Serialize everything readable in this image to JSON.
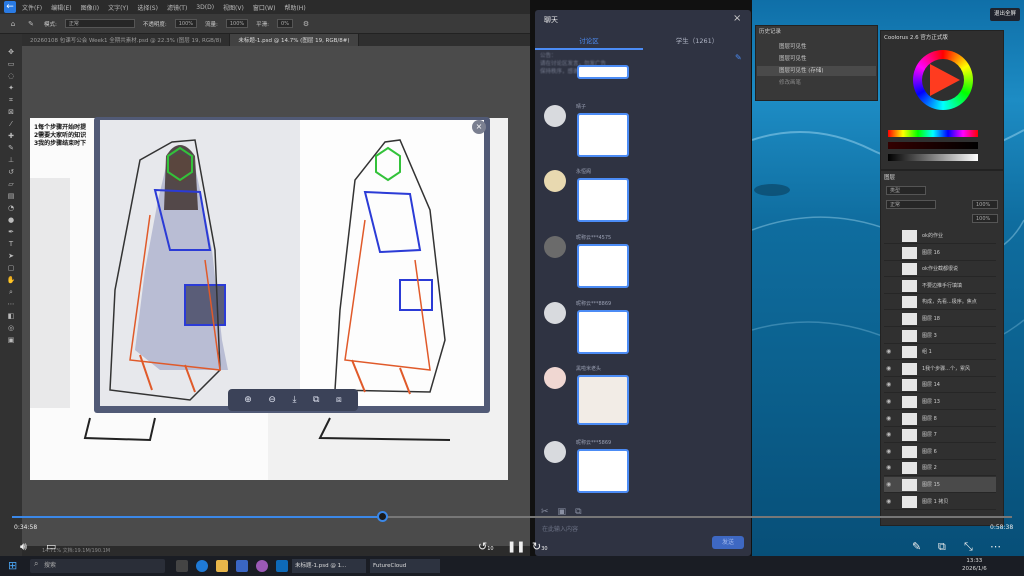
{
  "photoshop": {
    "menu": [
      "文件(F)",
      "编辑(E)",
      "图像(I)",
      "文字(Y)",
      "选择(S)",
      "滤镜(T)",
      "3D(D)",
      "视图(V)",
      "窗口(W)",
      "帮助(H)"
    ],
    "options": {
      "mode_label": "模式:",
      "mode_value": "正常",
      "opacity_label": "不透明度:",
      "opacity_value": "100%",
      "flow_label": "流量:",
      "flow_value": "100%",
      "smooth_label": "平滑:",
      "smooth_value": "0%"
    },
    "tabs": [
      "20260108 包课写公会 Week1 全期共素材.psd @ 22.3% (图层 19, RGB/8)",
      "未标题-1.psd @ 14.7% (图层 19, RGB/8#)"
    ],
    "canvas_notes": [
      "1每个步骤开始时提",
      "2需要大家听的知识",
      "3我的步骤结束时下"
    ],
    "status": "14.71%   文档:19.1M/190.1M"
  },
  "viewer": {
    "close": "×",
    "tools": [
      "⊕",
      "⊖",
      "⤓",
      "⧉",
      "⧈"
    ]
  },
  "chat": {
    "title": "聊天",
    "close": "×",
    "tabs": [
      "讨论区",
      "学生（1261）"
    ],
    "notice": "公告：\n请在讨论区发言，勿发广告\n保持秩序，感谢配合",
    "messages": [
      {
        "name": "晴子"
      },
      {
        "name": "永恒阁"
      },
      {
        "name": "昵称云***4575"
      },
      {
        "name": "昵称云***8869"
      },
      {
        "name": "黑啦米老头"
      },
      {
        "name": "昵称云***5869"
      }
    ],
    "input_placeholder": "在此输入内容",
    "send": "发送"
  },
  "desktop": {
    "exit_fullscreen": "退出全屏",
    "history_title": "历史记录",
    "history_items": [
      "图层可见性",
      "图层可见性",
      "图层可见性 (存储)",
      "修改画笔"
    ],
    "color_title": "Coolorus 2.6 官方正式版",
    "layers_title": "图层",
    "layers_kind": "类型",
    "layers_mode": "正常",
    "layers_opacity": "100%",
    "layers_fill": "100%",
    "layers": [
      "ok的作业",
      "图层 16",
      "ok作业截都很说",
      "不要边推手行填填",
      "构成，先看...极序。焦点",
      "图层 18",
      "图层 3",
      "组 1",
      "1我个步骤...个，累风",
      "图层 14",
      "图层 13",
      "图层 8",
      "图层 7",
      "图层 6",
      "图层 2",
      "图层 15",
      "图层 1 拷贝"
    ]
  },
  "player": {
    "current": "0:34:58",
    "total": "0:58:38",
    "progress": 0.37,
    "replay": "10",
    "forward": "30"
  },
  "taskbar": {
    "search": "搜索",
    "apps": [
      "未标题-1.psd @ 1...",
      "FutureCloud"
    ],
    "time": "13:33",
    "date": "2026/1/6"
  },
  "colors": {
    "accent": "#4c8cf5",
    "chat_bg": "#2f3342",
    "ps_bg": "#535353"
  }
}
